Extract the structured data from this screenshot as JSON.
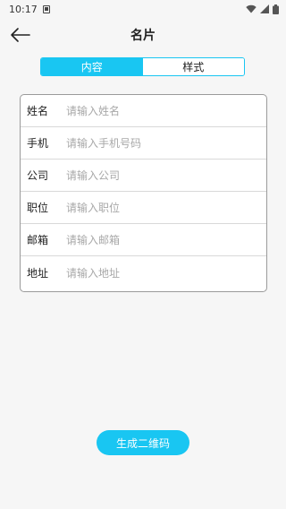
{
  "status_bar": {
    "time": "10:17",
    "icons": [
      "notification-icon",
      "wifi-icon",
      "signal-icon",
      "battery-icon"
    ]
  },
  "header": {
    "title": "名片",
    "back_icon": "arrow-left-icon"
  },
  "tabs": [
    {
      "label": "内容",
      "active": true
    },
    {
      "label": "样式",
      "active": false
    }
  ],
  "form": {
    "fields": [
      {
        "label": "姓名",
        "placeholder": "请输入姓名",
        "value": ""
      },
      {
        "label": "手机",
        "placeholder": "请输入手机号码",
        "value": ""
      },
      {
        "label": "公司",
        "placeholder": "请输入公司",
        "value": ""
      },
      {
        "label": "职位",
        "placeholder": "请输入职位",
        "value": ""
      },
      {
        "label": "邮箱",
        "placeholder": "请输入邮箱",
        "value": ""
      },
      {
        "label": "地址",
        "placeholder": "请输入地址",
        "value": ""
      }
    ]
  },
  "actions": {
    "generate_label": "生成二维码"
  },
  "colors": {
    "accent": "#19c6f2",
    "background": "#f6f6f6",
    "card_border": "#9a9a9a",
    "placeholder": "#a8a8a8"
  }
}
